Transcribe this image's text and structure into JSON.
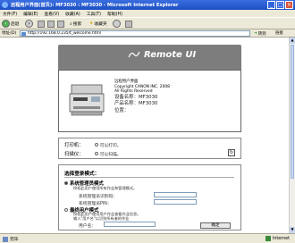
{
  "window": {
    "title": "远程用户界面(首页): MF3030 : MF3030 - Microsoft Internet Explorer"
  },
  "menu": [
    "文件(F)",
    "编辑(E)",
    "查看(V)",
    "收藏(A)",
    "工具(T)",
    "帮助(H)"
  ],
  "toolbar": {
    "back": "后退",
    "search": "搜索",
    "favorites": "收藏夹"
  },
  "address": {
    "label": "地址(D)",
    "url": "http://192.168.0.235/t_welcome.html",
    "go": "转到",
    "links": "链接"
  },
  "remote_ui": {
    "title": "Remote UI"
  },
  "device": {
    "product_label": "远程用户界面",
    "copyright": "Copyright CANON INC. 2008",
    "rights": "All Rights Reserved",
    "name_label": "设备名称：",
    "name_value": "MF3030",
    "product_name_label": "产品名称：",
    "product_name_value": "MF3030",
    "location_label": "位置："
  },
  "status": {
    "printer_label": "打印机：",
    "printer_value": "可以打印。",
    "scanner_label": "扫描仪：",
    "scanner_value": "可以扫描。"
  },
  "login": {
    "heading": "选择登录模式：",
    "admin_mode": "系统管理员模式",
    "admin_desc": "授权此用户使用所有作业和管理模式。",
    "admin_id_label": "系统管理员识别码：",
    "admin_pin_label": "系统管理员PIN：",
    "user_mode": "最终用户模式",
    "user_desc_1": "授权此用户使用用户作业查看作业信息。",
    "user_desc_2": "输入\"用户名\"以识别所有者的作业",
    "user_name_label": "用户名：",
    "login_button": "确定"
  },
  "statusbar": {
    "left": "完毕",
    "right": "Internet"
  }
}
